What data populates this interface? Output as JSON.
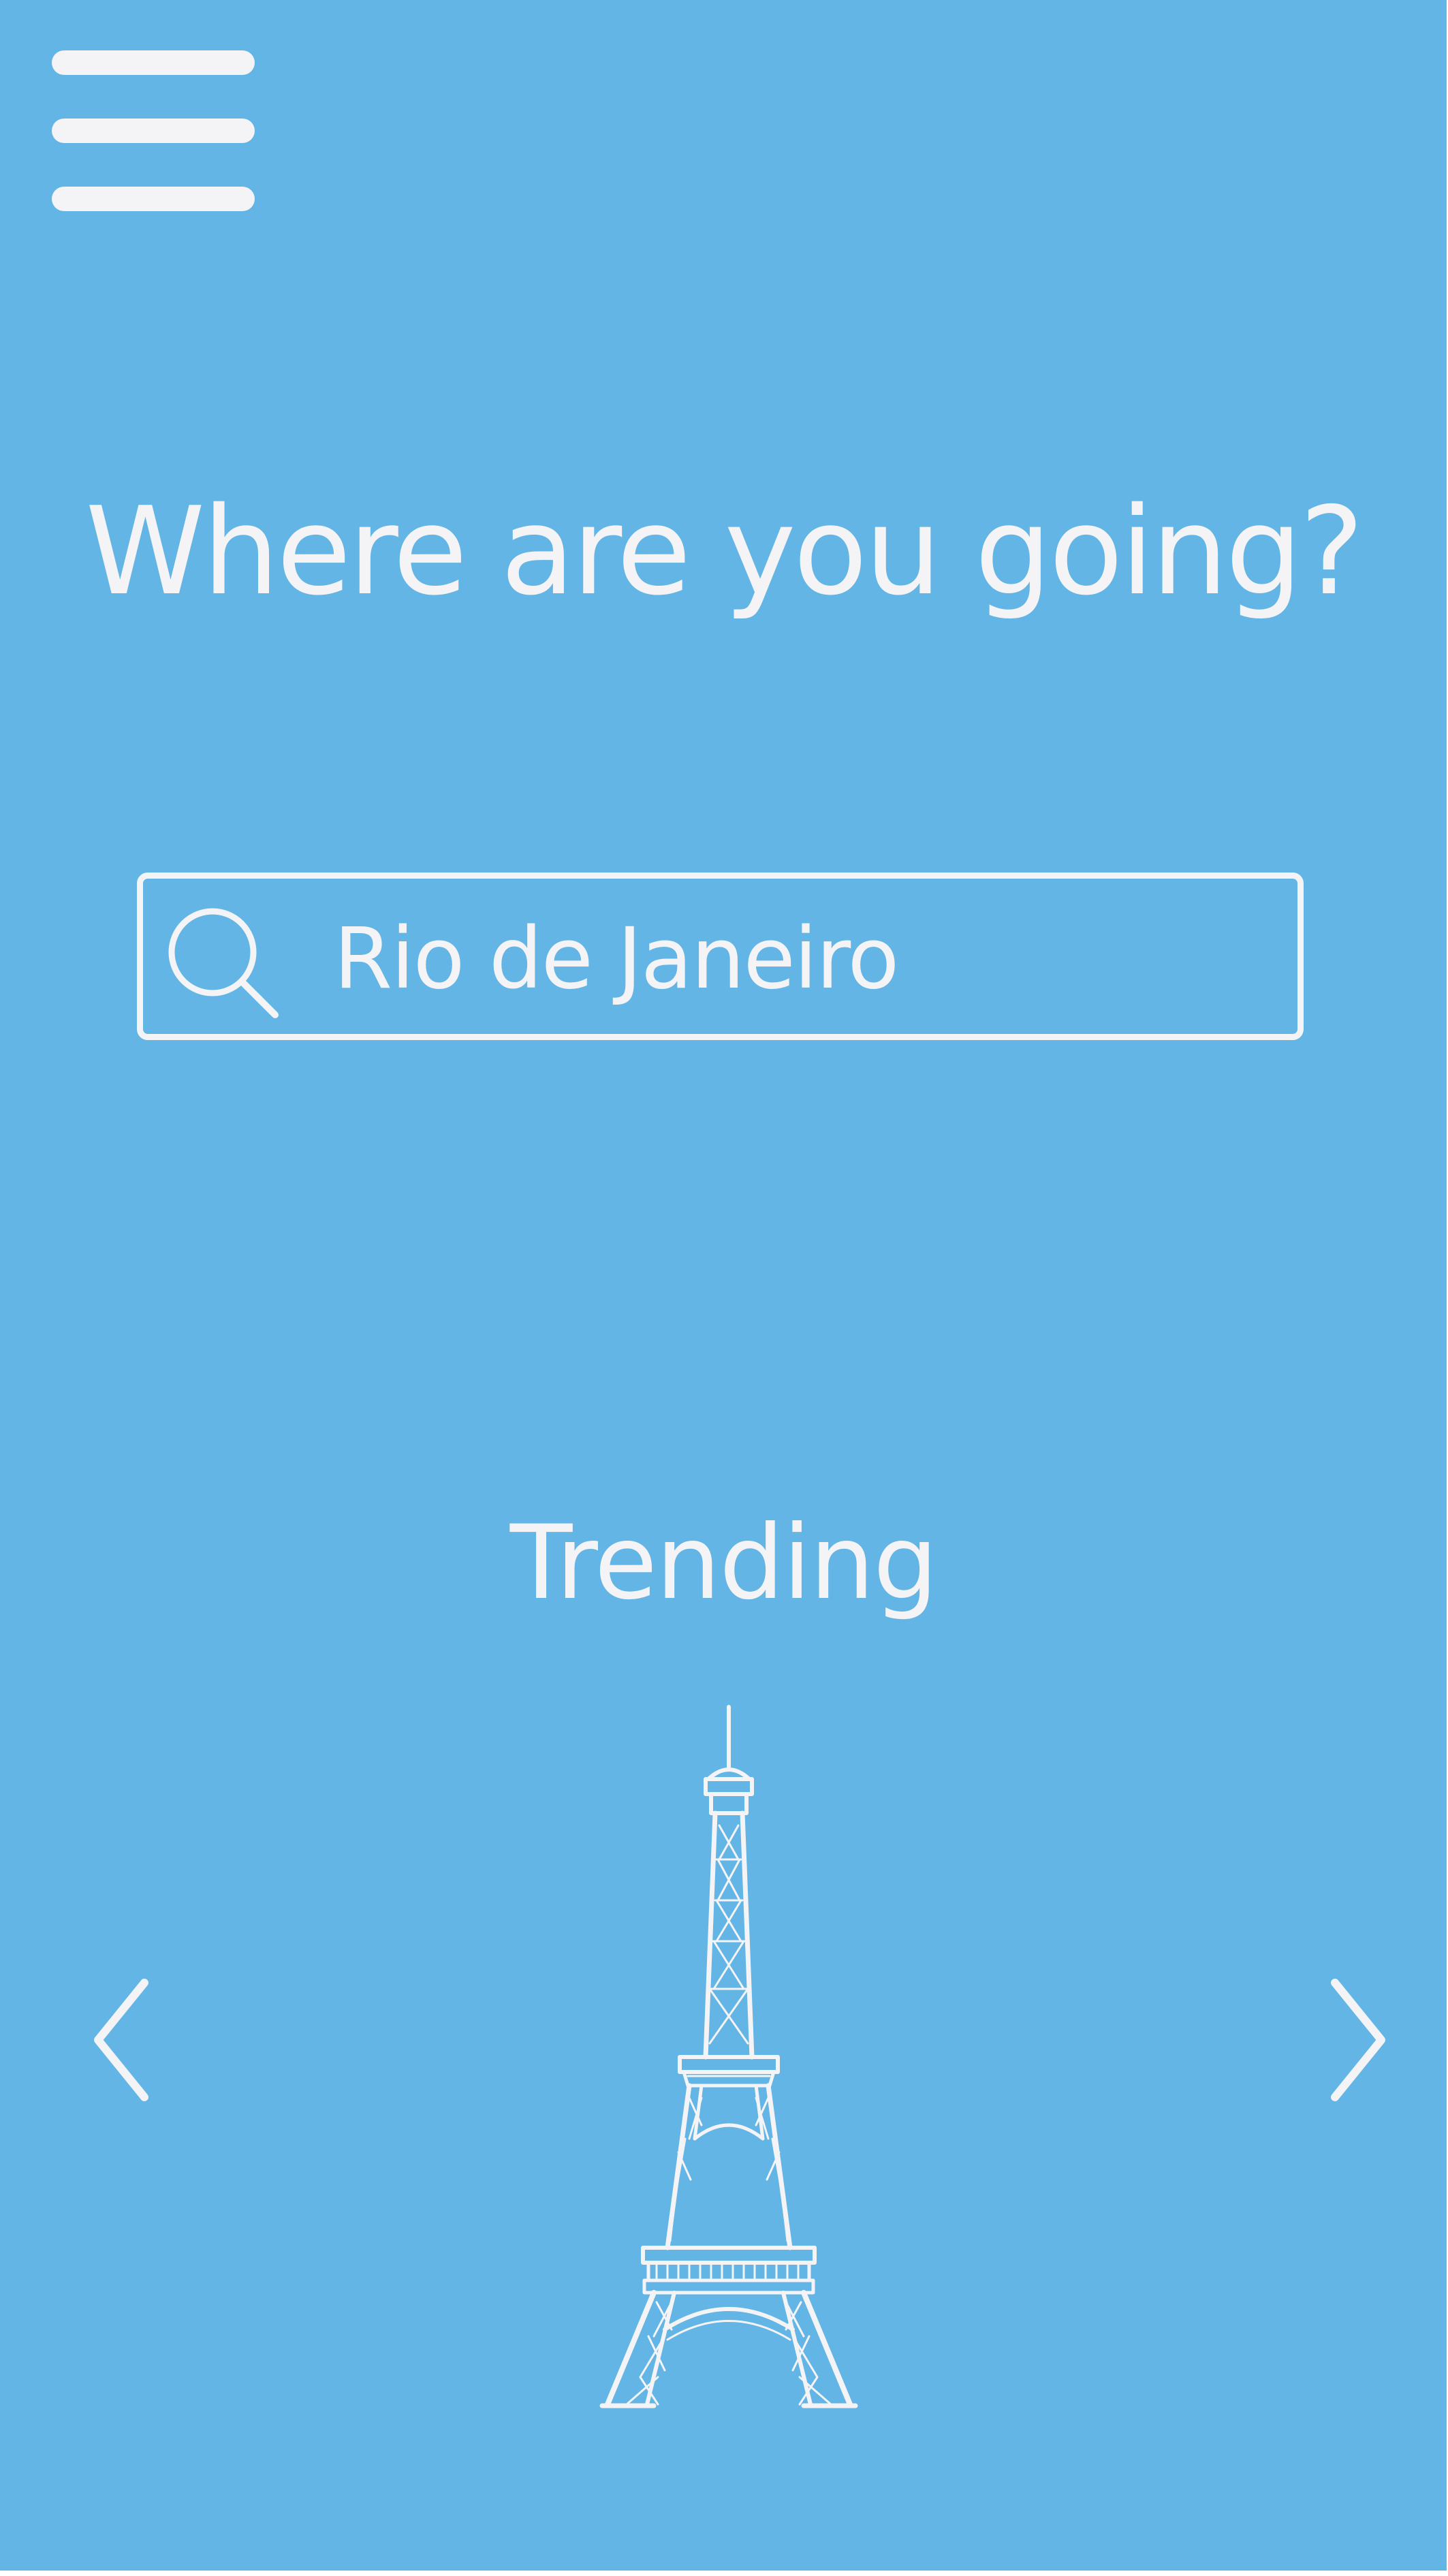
{
  "app": {
    "background_color": "#63b5e5",
    "foreground_color": "#f4f4f6"
  },
  "header": {
    "menu_icon": "hamburger-menu-icon"
  },
  "main": {
    "headline": "Where are you going?",
    "search": {
      "icon": "search-icon",
      "value": "Rio de Janeiro"
    }
  },
  "trending": {
    "title": "Trending",
    "prev_icon": "chevron-left-icon",
    "next_icon": "chevron-right-icon",
    "current_item_icon": "eiffel-tower-icon"
  }
}
